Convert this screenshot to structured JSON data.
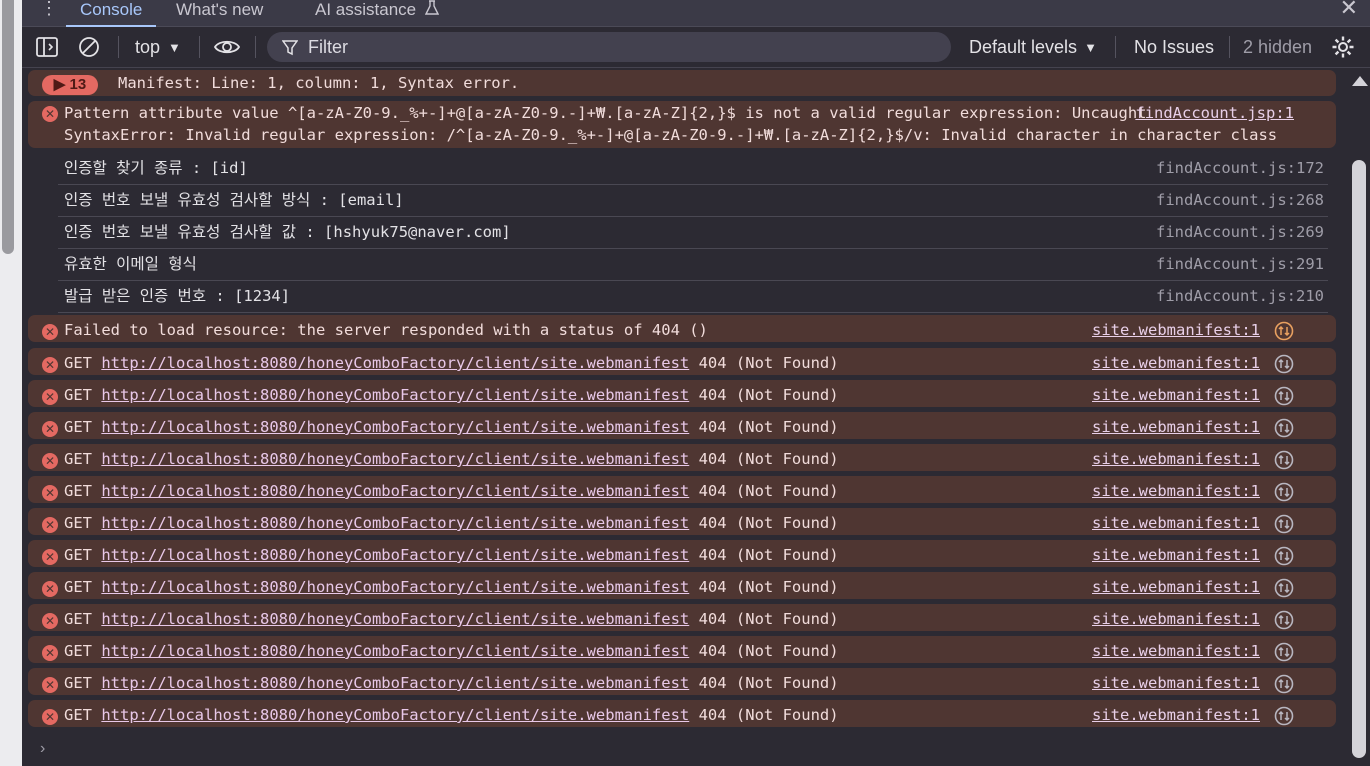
{
  "tabs": {
    "more": "⋮",
    "console": "Console",
    "whats_new": "What's new",
    "ai": "AI assistance",
    "close": "✕"
  },
  "toolbar": {
    "context": "top",
    "filter_placeholder": "Filter",
    "levels": "Default levels",
    "issues": "No Issues",
    "hidden": "2 hidden"
  },
  "messages": {
    "manifest": {
      "count": "13",
      "text": "Manifest: Line: 1, column: 1, Syntax error."
    },
    "pattern": {
      "line1": "Pattern attribute value ^[a-zA-Z0-9._%+-]+@[a-zA-Z0-9.-]+₩.[a-zA-Z]{2,}$ is not a valid regular expression: Uncaught",
      "line2": "SyntaxError: Invalid regular expression: /^[a-zA-Z0-9._%+-]+@[a-zA-Z0-9.-]+₩.[a-zA-Z]{2,}$/v: Invalid character in character class",
      "source": "findAccount.jsp:1"
    },
    "logs": [
      {
        "text": "인증할 찾기 종류 : [id]",
        "source": "findAccount.js:172"
      },
      {
        "text": "인증 번호 보낼 유효성 검사할 방식 : [email]",
        "source": "findAccount.js:268"
      },
      {
        "text": "인증 번호 보낼 유효성 검사할 값 : [hshyuk75@naver.com]",
        "source": "findAccount.js:269"
      },
      {
        "text": "유효한 이메일 형식",
        "source": "findAccount.js:291"
      },
      {
        "text": "발급 받은 인증 번호 : [1234]",
        "source": "findAccount.js:210"
      }
    ],
    "failed": {
      "text": "Failed to load resource: the server responded with a status of 404 ()",
      "source": "site.webmanifest:1"
    },
    "get": {
      "method": "GET",
      "url": "http://localhost:8080/honeyComboFactory/client/site.webmanifest",
      "status": "404 (Not Found)",
      "source": "site.webmanifest:1"
    }
  },
  "colors": {
    "error_bg": "#4f3632",
    "panel_bg": "#2c2a33",
    "accent": "#a8c7fa"
  }
}
